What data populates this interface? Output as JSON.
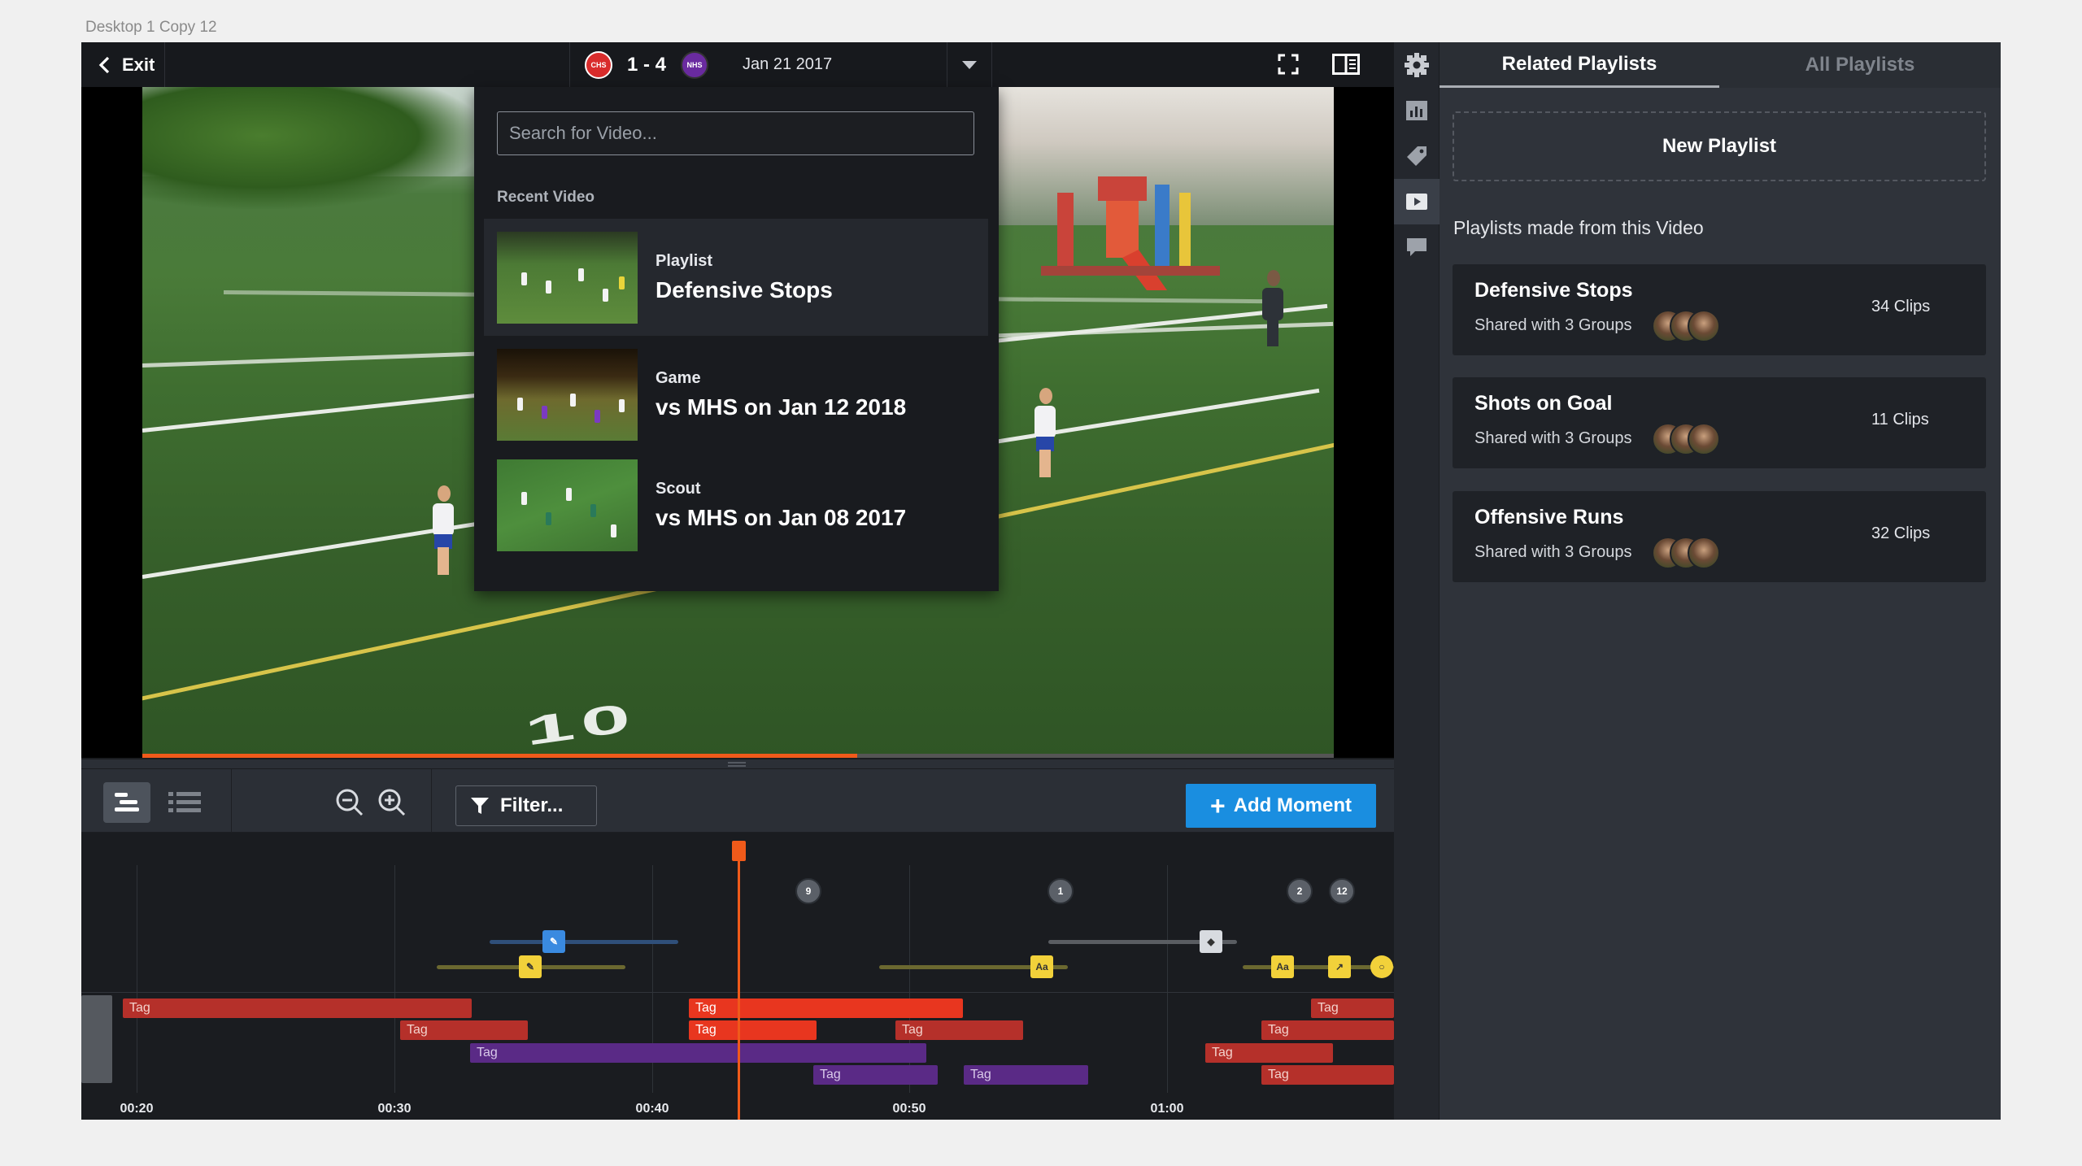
{
  "artboard": {
    "label": "Desktop 1 Copy 12"
  },
  "topbar": {
    "exit_label": "Exit",
    "home_team": "CHS",
    "away_team": "NHS",
    "score": "1 - 4",
    "date": "Jan 21 2017",
    "home_color": "#d92c2c",
    "away_color": "#6a2ba0"
  },
  "video": {
    "progress": 0.6
  },
  "picker": {
    "search_placeholder": "Search for Video...",
    "heading": "Recent Video",
    "items": [
      {
        "type": "Playlist",
        "title": "Defensive Stops"
      },
      {
        "type": "Game",
        "title": "vs MHS on Jan 12 2018"
      },
      {
        "type": "Scout",
        "title": "vs MHS on Jan 08 2017"
      }
    ]
  },
  "timeline_toolbar": {
    "filter_label": "Filter...",
    "add_moment_label": "Add Moment",
    "add_moment_color": "#1a8ee0"
  },
  "timeline": {
    "time_labels": [
      "00:20",
      "00:30",
      "00:40",
      "00:50",
      "01:00"
    ],
    "comment_bubbles": [
      "9",
      "1",
      "2",
      "12"
    ],
    "marker_labels": {
      "text": "Aa",
      "text2": "Aa"
    },
    "tag_label": "Tag",
    "playhead_color": "#f05a1a"
  },
  "panel": {
    "tab_related": "Related Playlists",
    "tab_all": "All Playlists",
    "new_playlist": "New Playlist",
    "subtitle": "Playlists made from this Video",
    "playlists": [
      {
        "title": "Defensive Stops",
        "shared": "Shared with 3 Groups",
        "count": "34 Clips"
      },
      {
        "title": "Shots on Goal",
        "shared": "Shared with 3 Groups",
        "count": "11 Clips"
      },
      {
        "title": "Offensive Runs",
        "shared": "Shared with 3 Groups",
        "count": "32 Clips"
      }
    ]
  },
  "icons": {
    "rail": [
      "gear-icon",
      "chart-icon",
      "tag-icon",
      "video-icon",
      "comment-icon"
    ],
    "topbar": [
      "fullscreen-icon",
      "panel-layout-icon"
    ],
    "toolbar": [
      "timeline-view-icon",
      "list-view-icon",
      "zoom-out-icon",
      "zoom-in-icon",
      "filter-icon"
    ]
  }
}
